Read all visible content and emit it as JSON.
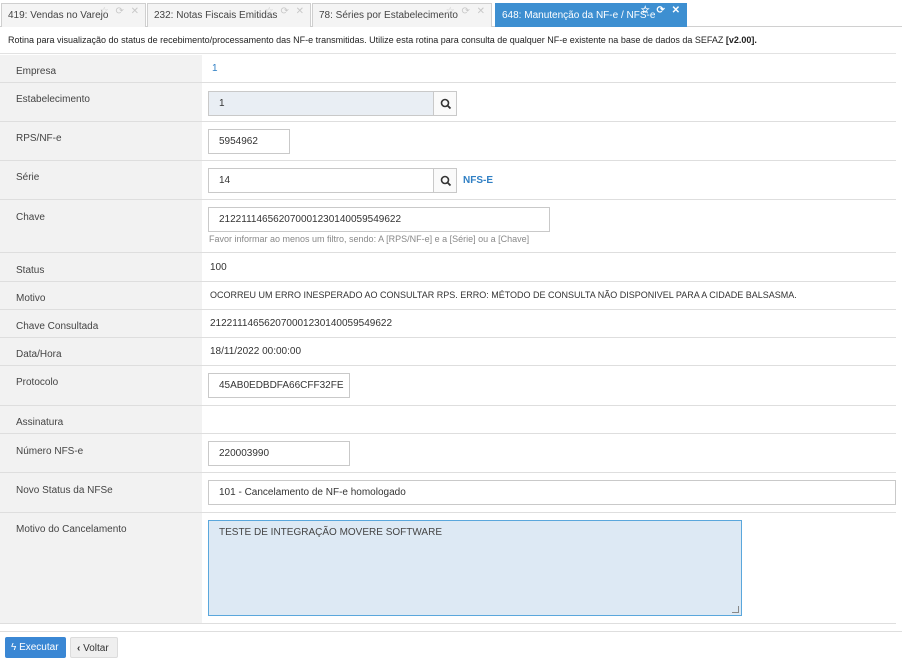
{
  "tabs": [
    {
      "label": "419: Vendas no Varejo",
      "icons": "☆ ⟳ ✕"
    },
    {
      "label": "232: Notas Fiscais Emitidas",
      "icons": "☆ ⟳ ✕"
    },
    {
      "label": "78: Séries por Estabelecimento",
      "icons": "☆ ⟳ ✕"
    },
    {
      "label": "648: Manutenção da NF-e / NFS-e",
      "icons": "☆ ⟳ ✕"
    }
  ],
  "description": {
    "text": "Rotina para visualização do status de recebimento/processamento das NF-e transmitidas. Utilize esta rotina para consulta de qualquer NF-e existente na base de dados da SEFAZ ",
    "version": "[v2.00]."
  },
  "form": {
    "empresa": {
      "label": "Empresa",
      "value": "1"
    },
    "estabelecimento": {
      "label": "Estabelecimento",
      "value": "1"
    },
    "rps": {
      "label": "RPS/NF-e",
      "value": "5954962"
    },
    "serie": {
      "label": "Série",
      "value": "14",
      "tag": "NFS-E"
    },
    "chave": {
      "label": "Chave",
      "value": "21221114656207000123014005954962​2",
      "hint": "Favor informar ao menos um filtro, sendo: A [RPS/NF-e] e a [Série] ou a [Chave]"
    },
    "status": {
      "label": "Status",
      "value": "100"
    },
    "motivo": {
      "label": "Motivo",
      "value": "OCORREU UM ERRO INESPERADO AO CONSULTAR RPS. ERRO: MÉTODO DE CONSULTA NÃO DISPONIVEL PARA A CIDADE BALSASMA."
    },
    "chave_consultada": {
      "label": "Chave Consultada",
      "value": "21221114656207000123014005954962​2"
    },
    "data_hora": {
      "label": "Data/Hora",
      "value": "18/11/2022 00:00:00"
    },
    "protocolo": {
      "label": "Protocolo",
      "value": "45AB0EDBDFA66CFF32FE"
    },
    "assinatura": {
      "label": "Assinatura"
    },
    "numero_nfse": {
      "label": "Número NFS-e",
      "value": "220003990"
    },
    "novo_status": {
      "label": "Novo Status da NFSe",
      "value": "101 - Cancelamento de NF-e homologado"
    },
    "motivo_cancelamento": {
      "label": "Motivo do Cancelamento",
      "value": "TESTE DE INTEGRAÇÃO MOVERE SOFTWARE"
    }
  },
  "footer": {
    "execute_label": "Executar",
    "back_label": "Voltar"
  }
}
